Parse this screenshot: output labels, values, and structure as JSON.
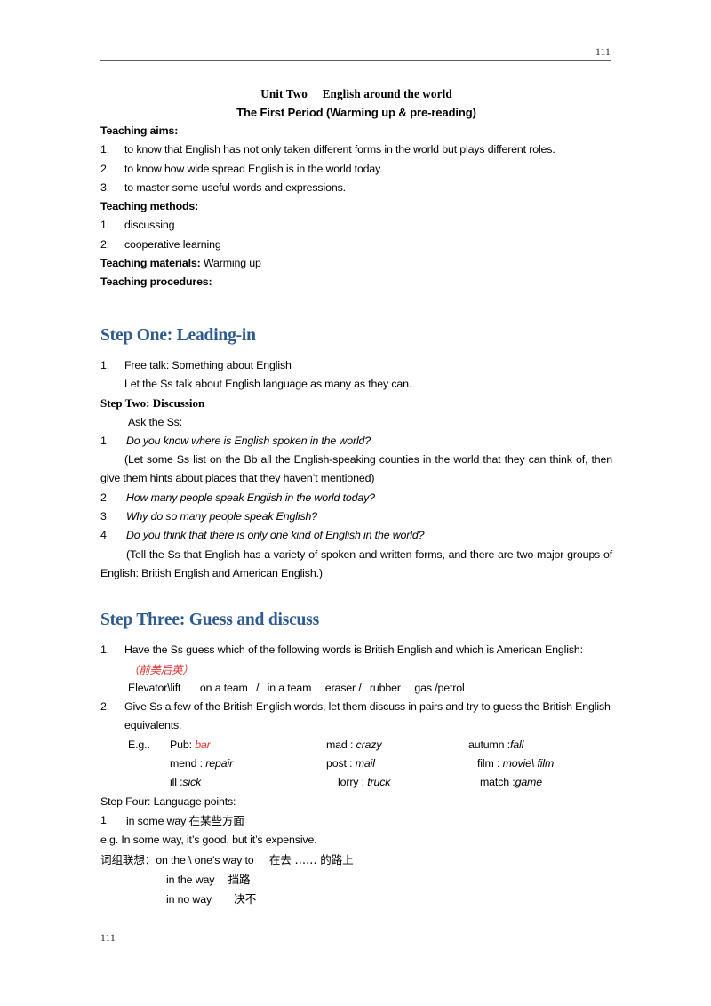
{
  "header": {
    "page_number": "111"
  },
  "footer": {
    "page_number": "111"
  },
  "colors": {
    "heading_blue": "#2e5a8c",
    "accent_red": "#e03030",
    "rule_gray": "#5d5d5d"
  },
  "title": {
    "line1": "Unit Two  English around the world",
    "line2": "The First Period (Warming up & pre-reading)"
  },
  "teaching_aims": {
    "label": "Teaching aims:",
    "items": [
      {
        "num": "1.",
        "text": "to know that English has not only taken different forms in the world but plays different roles."
      },
      {
        "num": "2.",
        "text": "to know how wide spread English is in the world today."
      },
      {
        "num": "3.",
        "text": "to master some useful words and expressions."
      }
    ]
  },
  "teaching_methods": {
    "label": "Teaching methods:",
    "items": [
      {
        "num": "1.",
        "text": "discussing"
      },
      {
        "num": "2.",
        "text": "cooperative learning"
      }
    ]
  },
  "teaching_materials": {
    "label": "Teaching materials:",
    "value": "Warming up"
  },
  "teaching_procedures": {
    "label": "Teaching procedures:"
  },
  "step_one": {
    "heading": "Step One: Leading-in",
    "item_num": "1.",
    "item_text": "Free talk: Something about English",
    "sub_text": "Let the Ss talk about English language as many as they can."
  },
  "step_two": {
    "heading": "Step Two: Discussion",
    "ask": "Ask the Ss:",
    "questions": [
      {
        "num": "1",
        "text": "Do you know where is English spoken in the world?"
      },
      {
        "num": "2",
        "text": "How many people speak English in the world today?"
      },
      {
        "num": "3",
        "text": "Why do so many people speak English?"
      },
      {
        "num": "4",
        "text": "Do you think that there is only one kind of English in the world?"
      }
    ],
    "note1": "(Let some Ss list on the Bb all the English-speaking counties in the world that they can think of, then give them hints about places that they haven’t mentioned)",
    "note2": "(Tell the Ss that English has a variety of spoken and written forms, and there are two major groups of English: British English and American English.)"
  },
  "step_three": {
    "heading": "Step Three: Guess and discuss",
    "item1_num": "1.",
    "item1_text": "Have the Ss guess which of the following words is British English and which is American English:",
    "red_note": "（前美后英）",
    "word_line": "Elevator\\lift   on a team  /  in a team  eraser /  rubber  gas /petrol",
    "item2_num": "2.",
    "item2_text": "Give Ss a few of the British English words, let them discuss in pairs and try to guess the British English equivalents.",
    "eg_label": "E.g..",
    "pairs": [
      {
        "c1_plain": "Pub: ",
        "c1_ital": "bar",
        "c1_red": true,
        "c2_plain": "mad : ",
        "c2_ital": "crazy",
        "c3_plain": "autumn :",
        "c3_ital": "fall"
      },
      {
        "c1_plain": "mend : ",
        "c1_ital": "repair",
        "c1_red": false,
        "c2_plain": "post : ",
        "c2_ital": "mail",
        "c3_plain": "film : ",
        "c3_ital": "movie\\ film"
      },
      {
        "c1_plain": "ill :",
        "c1_ital": "sick",
        "c1_red": false,
        "c2_plain": "lorry : ",
        "c2_ital": "truck",
        "c3_plain": "match :",
        "c3_ital": "game"
      }
    ]
  },
  "step_four": {
    "heading": "Step Four: Language points:",
    "point_num": "1",
    "point_en": "in some way",
    "point_cn": "在某些方面",
    "example": "e.g. In some way, it’s good, but it’s expensive.",
    "assoc_label": "词组联想：",
    "assoc_first_en": "on the \\ one’s way to",
    "assoc_first_cn": "在去 …… 的路上",
    "assoc_rows": [
      {
        "en": "in the way",
        "cn": "挡路"
      },
      {
        "en": "in no way",
        "cn": "决不"
      }
    ]
  }
}
